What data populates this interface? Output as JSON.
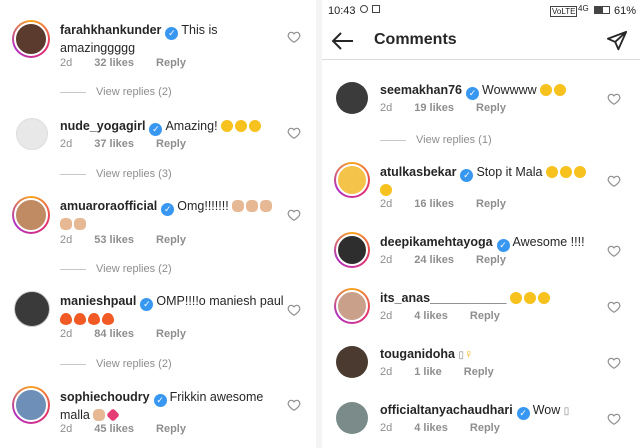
{
  "left": {
    "comments": [
      {
        "user": "farahkhankunder",
        "text": "This is amazinggggg",
        "emoji": "",
        "time": "2d",
        "likes": "32 likes",
        "reply": "Reply",
        "view_replies": "View replies (2)"
      },
      {
        "user": "nude_yogagirl",
        "text": "Amazing!",
        "emoji": "laughing-emoji x3",
        "time": "2d",
        "likes": "37 likes",
        "reply": "Reply",
        "view_replies": "View replies (3)"
      },
      {
        "user": "amuaroraofficial",
        "text": "Omg!!!!!!!",
        "emoji": "clapping-hands-emoji x5",
        "time": "2d",
        "likes": "53 likes",
        "reply": "Reply",
        "view_replies": "View replies (2)"
      },
      {
        "user": "manieshpaul",
        "text": "OMP!!!!o maniesh paul",
        "emoji": "fire-emoji x4",
        "time": "2d",
        "likes": "84 likes",
        "reply": "Reply",
        "view_replies": "View replies (2)"
      },
      {
        "user": "sophiechoudry",
        "text": "Frikkin awesome malla",
        "emoji": "hands-heart-emoji",
        "time": "2d",
        "likes": "45 likes",
        "reply": "Reply",
        "view_replies": ""
      }
    ]
  },
  "right": {
    "status": {
      "time": "10:43",
      "network": "VoLTE",
      "signal": "4G",
      "battery": "61%"
    },
    "header": {
      "title": "Comments"
    },
    "comments": [
      {
        "user": "seemakhan76",
        "text": "Wowwww",
        "time": "2d",
        "likes": "19 likes",
        "reply": "Reply",
        "view_replies": "View replies (1)"
      },
      {
        "user": "atulkasbekar",
        "text": "Stop it Mala",
        "time": "2d",
        "likes": "16 likes",
        "reply": "Reply",
        "view_replies": ""
      },
      {
        "user": "deepikamehtayoga",
        "text": "Awesome !!!!",
        "time": "2d",
        "likes": "24 likes",
        "reply": "Reply",
        "view_replies": ""
      },
      {
        "user": "its_anas___________",
        "text": "",
        "time": "2d",
        "likes": "4 likes",
        "reply": "Reply",
        "view_replies": ""
      },
      {
        "user": "touganidoha",
        "text": "\u0000",
        "time": "2d",
        "likes": "1 like",
        "reply": "Reply",
        "view_replies": ""
      },
      {
        "user": "officialtanyachaudhari",
        "text": "Wow",
        "time": "2d",
        "likes": "4 likes",
        "reply": "Reply",
        "view_replies": ""
      }
    ]
  },
  "colors": {
    "verified": "#3897f0",
    "muted": "#8e8e8e",
    "text": "#262626"
  }
}
